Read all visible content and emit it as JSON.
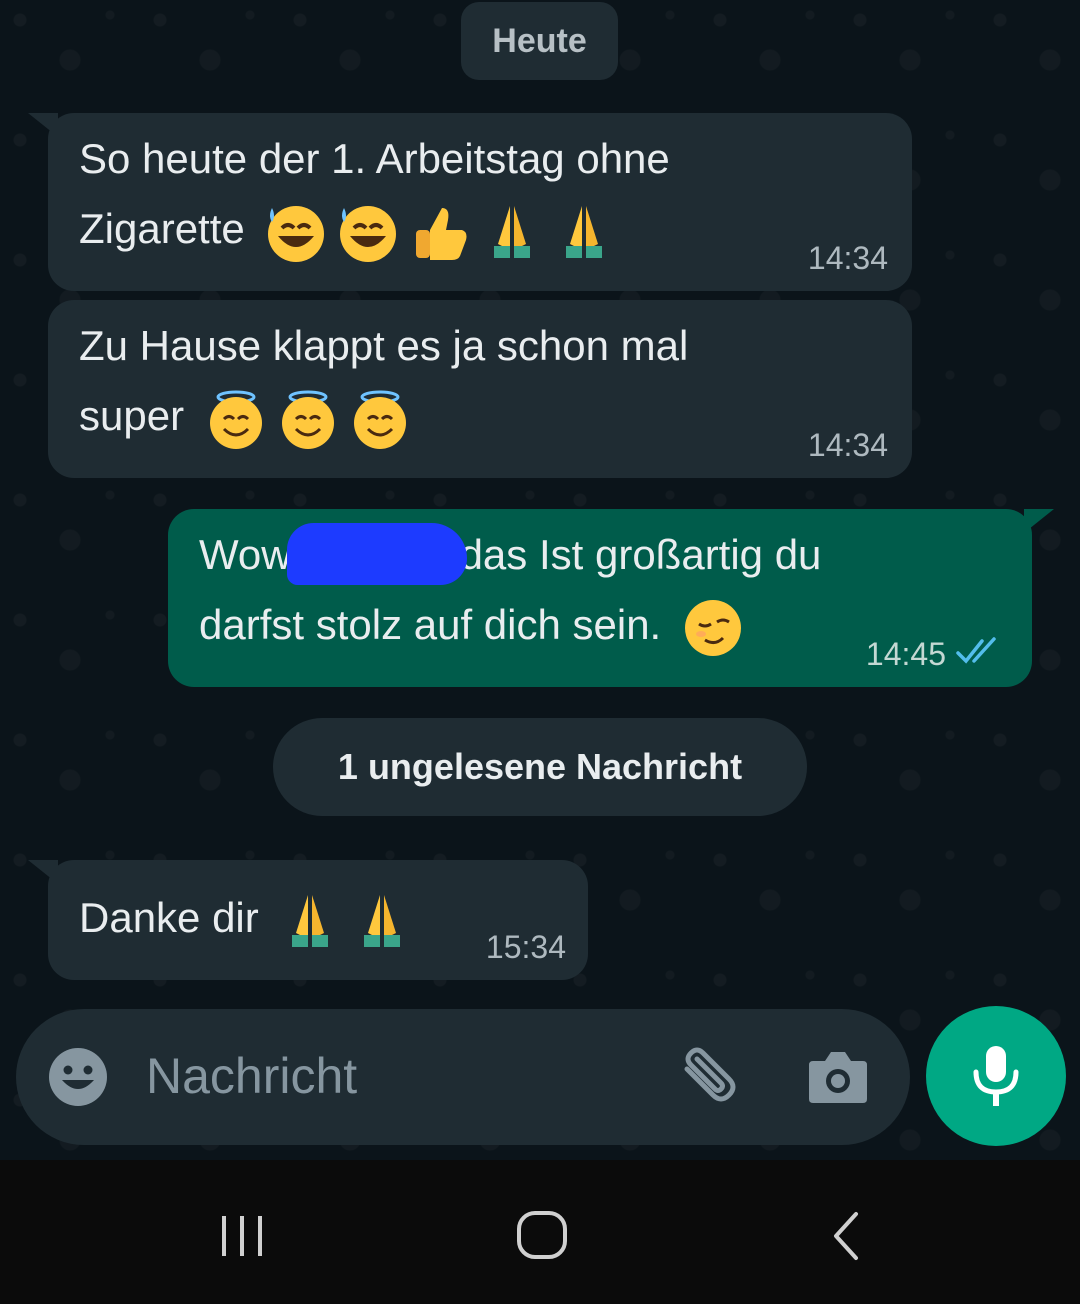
{
  "chat": {
    "date_chip": "Heute",
    "messages": [
      {
        "line1": "So heute der 1. Arbeitstag ohne",
        "line2": "Zigarette",
        "time": "14:34"
      },
      {
        "line1": "Zu Hause klappt es ja schon mal",
        "line2": "super",
        "time": "14:34"
      },
      {
        "line1_a": "Wow",
        "line1_b": "das Ist großartig du",
        "line2": "darfst stolz auf dich sein.",
        "time": "14:45"
      },
      {
        "line1": "Danke dir",
        "time": "15:34"
      }
    ],
    "unread_label": "1 ungelesene Nachricht"
  },
  "composer": {
    "placeholder": "Nachricht"
  },
  "icons": {
    "emoji": "emoji-face-icon",
    "attach": "paperclip-icon",
    "camera": "camera-icon",
    "mic": "microphone-icon",
    "read_receipt": "double-check-icon"
  },
  "colors": {
    "background": "#0b141a",
    "incoming_bubble": "#1f2c33",
    "outgoing_bubble": "#005c4b",
    "accent": "#00a884",
    "read_tick": "#53bdeb"
  }
}
